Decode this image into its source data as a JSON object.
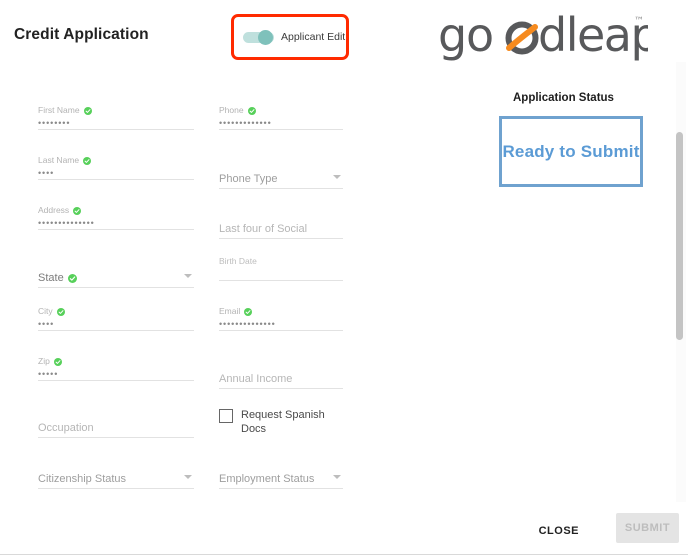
{
  "header": {
    "title": "Credit Application",
    "toggle": {
      "label": "Applicant Edit",
      "state": "on",
      "track_color": "#bfe0dd",
      "knob_color": "#7fc1bb",
      "highlight_color": "#ff2a00"
    },
    "logo": {
      "text": "goodleap",
      "trademark": "™",
      "word_color": "#58595b",
      "accent_color": "#f68b1f"
    }
  },
  "form": {
    "left_column": [
      {
        "label": "First Name",
        "value": "••••••••",
        "verified": true,
        "type": "text"
      },
      {
        "label": "Last Name",
        "value": "••••",
        "verified": true,
        "type": "text"
      },
      {
        "label": "Address",
        "value": "••••••••••••••",
        "verified": true,
        "type": "text"
      },
      {
        "label": "State",
        "value": "",
        "verified": true,
        "type": "select"
      },
      {
        "label": "City",
        "value": "••••",
        "verified": true,
        "type": "text"
      },
      {
        "label": "Zip",
        "value": "•••••",
        "verified": true,
        "type": "text"
      },
      {
        "label": "Occupation",
        "value": "",
        "verified": false,
        "type": "empty"
      },
      {
        "label": "Citizenship Status",
        "value": "",
        "verified": false,
        "type": "select"
      }
    ],
    "right_column": [
      {
        "label": "Phone",
        "value": "•••••••••••••",
        "verified": true,
        "type": "text"
      },
      {
        "label": "Phone Type",
        "value": "",
        "verified": false,
        "type": "select"
      },
      {
        "label": "Last four of Social",
        "value": "",
        "verified": false,
        "type": "empty"
      },
      {
        "label": "Birth Date",
        "value": "",
        "verified": false,
        "type": "small-empty"
      },
      {
        "label": "Email",
        "value": "••••••••••••••",
        "verified": true,
        "type": "text"
      },
      {
        "label": "Annual Income",
        "value": "",
        "verified": false,
        "type": "empty"
      },
      {
        "label": "Employment Status",
        "value": "",
        "verified": false,
        "type": "select"
      }
    ],
    "checkbox": {
      "label": "Request Spanish Docs",
      "checked": false
    }
  },
  "status_panel": {
    "title": "Application Status",
    "value": "Ready to Submit",
    "border_color": "#6fa2cf",
    "text_color": "#5b9bd5"
  },
  "footer": {
    "close_label": "CLOSE",
    "submit_label": "SUBMIT",
    "submit_disabled": true
  }
}
